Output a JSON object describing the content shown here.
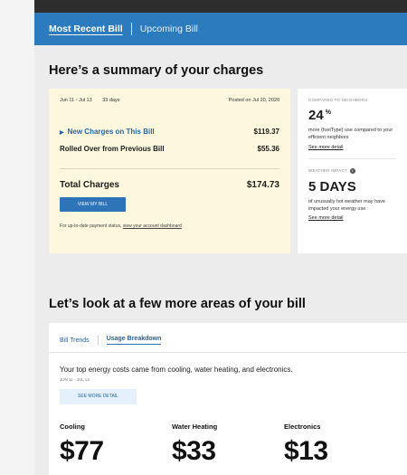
{
  "tabs": [
    {
      "label": "Most Recent Bill",
      "active": true
    },
    {
      "label": "Upcoming Bill",
      "active": false
    }
  ],
  "summary": {
    "title": "Here’s a summary of your charges",
    "period": "Jun 11 - Jul 13",
    "days": "33 days",
    "posted": "Posted on Jul 20, 2020",
    "new_charges_label": "New Charges on This Bill",
    "new_charges_value": "$119.37",
    "rolled_over_label": "Rolled Over from Previous Bill",
    "rolled_over_value": "$55.36",
    "total_label": "Total Charges",
    "total_value": "$174.73",
    "view_bill_button": "VIEW MY BILL",
    "footnote_text": "For up-to-date payment status,",
    "footnote_link": "view your account dashboard"
  },
  "neighbors": {
    "eyebrow": "COMPARED TO NEIGHBORS",
    "value": "24",
    "unit": "%",
    "desc": "more {fuelType} use compared to your efficient neighbors",
    "link": "See more detail"
  },
  "weather": {
    "eyebrow": "WEATHER IMPACT",
    "value": "5 DAYS",
    "desc": "of unusually hot weather may have impacted your energy use",
    "link": "See more detail"
  },
  "areas": {
    "title": "Let’s look at a few more areas of your bill",
    "tabs": [
      {
        "label": "Bill Trends",
        "active": false
      },
      {
        "label": "Usage Breakdown",
        "active": true
      }
    ],
    "text": "Your top energy costs came from cooling, water heating, and electronics.",
    "date": "JUN 11 - JUL 13",
    "button": "SEE MORE DETAIL",
    "costs": [
      {
        "label": "Cooling",
        "amount": "$77"
      },
      {
        "label": "Water Heating",
        "amount": "$33"
      },
      {
        "label": "Electronics",
        "amount": "$13"
      }
    ]
  },
  "colors": {
    "brand_blue": "#2d7bbf",
    "bill_card_bg": "#fcf7dd",
    "link_blue": "#2068ad"
  }
}
